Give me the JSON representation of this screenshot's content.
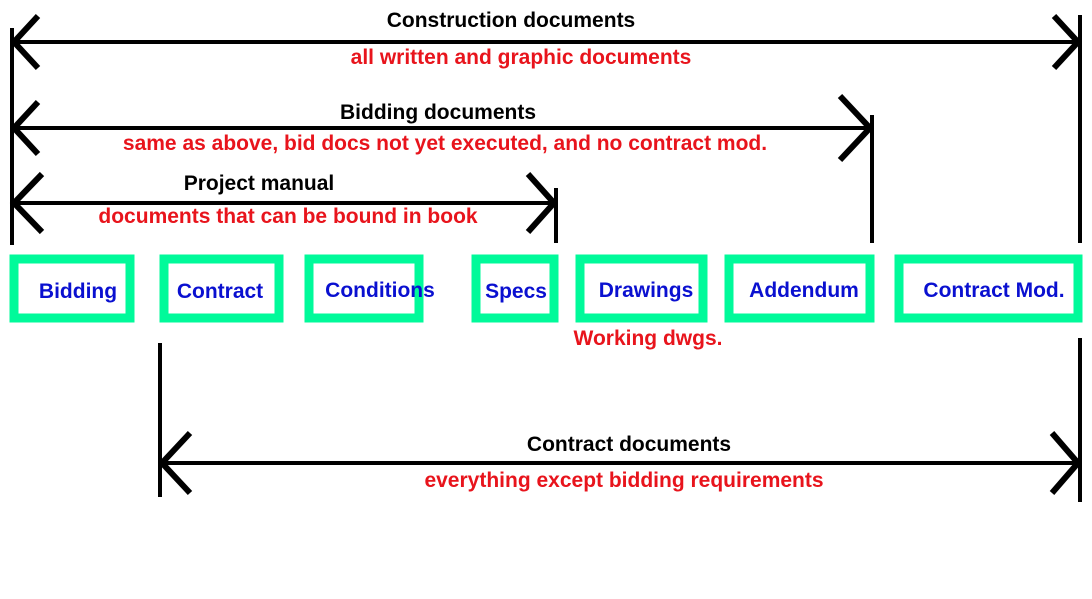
{
  "spans": [
    {
      "id": "construction",
      "label": "Construction documents",
      "note": "all written and graphic documents"
    },
    {
      "id": "bidding",
      "label": "Bidding documents",
      "note": "same as above, bid docs not yet executed, and no contract mod."
    },
    {
      "id": "project-manual",
      "label": "Project manual",
      "note": "documents that can be bound in book"
    },
    {
      "id": "contract",
      "label": "Contract documents",
      "note": "everything except bidding requirements"
    }
  ],
  "boxes": [
    "Bidding",
    "Contract",
    "Conditions",
    "Specs",
    "Drawings",
    "Addendum",
    "Contract Mod."
  ],
  "drawings_note": "Working dwgs.",
  "colors": {
    "box_border": "#00fa9a",
    "box_text": "#0a10d0",
    "note": "#e8141c",
    "label": "#000000"
  }
}
